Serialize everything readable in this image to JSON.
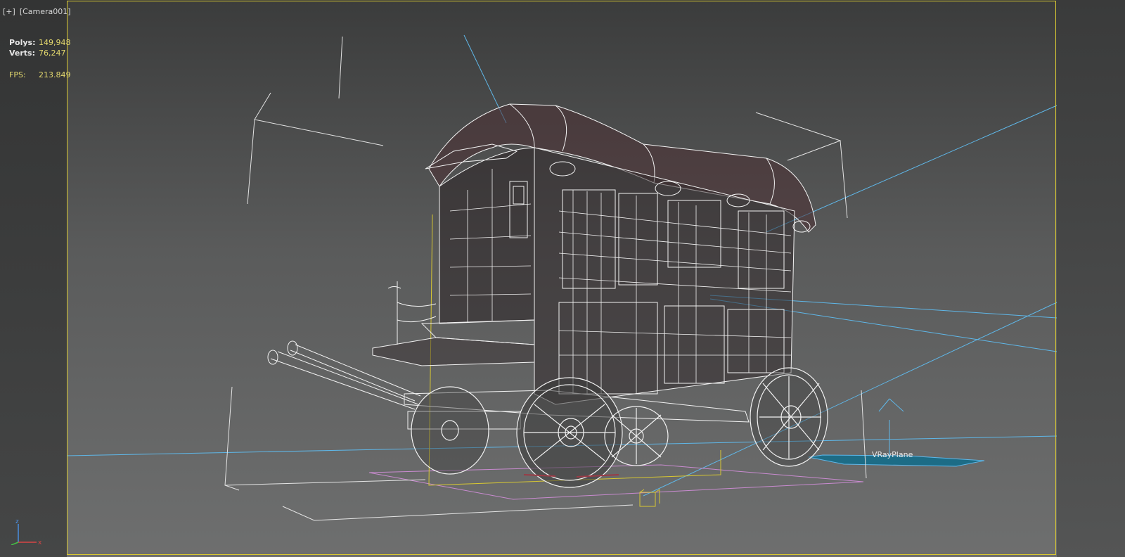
{
  "viewport": {
    "plus_label": "[+]",
    "camera_label": "[Camera001]"
  },
  "stats": {
    "polys_label": "Polys:",
    "polys_value": "149,948",
    "verts_label": "Verts:",
    "verts_value": "76,247",
    "fps_label": "FPS:",
    "fps_value": "213.849"
  },
  "scene": {
    "object_label": "VRayPlane"
  },
  "gizmo": {
    "z_label": "z",
    "x_label": "x"
  },
  "colors": {
    "safe_frame": "#d8c832",
    "stat_value": "#e3d86e",
    "camera_line": "#5fb7e8",
    "plane_outline": "#c98bd0",
    "wire": "#f2f2f2"
  }
}
